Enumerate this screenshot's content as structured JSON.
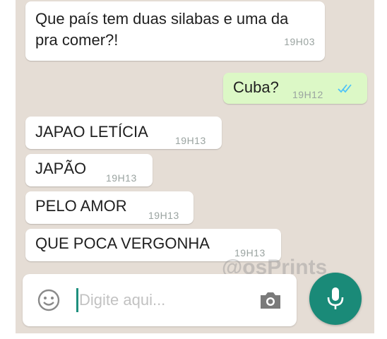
{
  "messages": [
    {
      "direction": "incoming",
      "text": "Que país tem duas silabas e uma da pra comer?!",
      "time": "19H03"
    },
    {
      "direction": "outgoing",
      "text": "Cuba?",
      "time": "19H12",
      "status_icon": "double-check-icon"
    },
    {
      "direction": "incoming",
      "text": "JAPAO LETÍCIA",
      "time": "19H13"
    },
    {
      "direction": "incoming",
      "text": "JAPÃO",
      "time": "19H13"
    },
    {
      "direction": "incoming",
      "text": "PELO AMOR",
      "time": "19H13"
    },
    {
      "direction": "incoming",
      "text": "QUE POCA VERGONHA",
      "time": "19H13"
    }
  ],
  "watermark": "@osPrints",
  "composer": {
    "placeholder": "Digite aqui...",
    "value": "",
    "emoji_icon": "emoji-icon",
    "camera_icon": "camera-icon",
    "mic_icon": "microphone-icon"
  },
  "colors": {
    "chat_background": "#e5ddd5",
    "incoming_bubble": "#ffffff",
    "outgoing_bubble": "#dcf8c6",
    "read_ticks": "#4fc3f7",
    "accent": "#1a8a78"
  }
}
